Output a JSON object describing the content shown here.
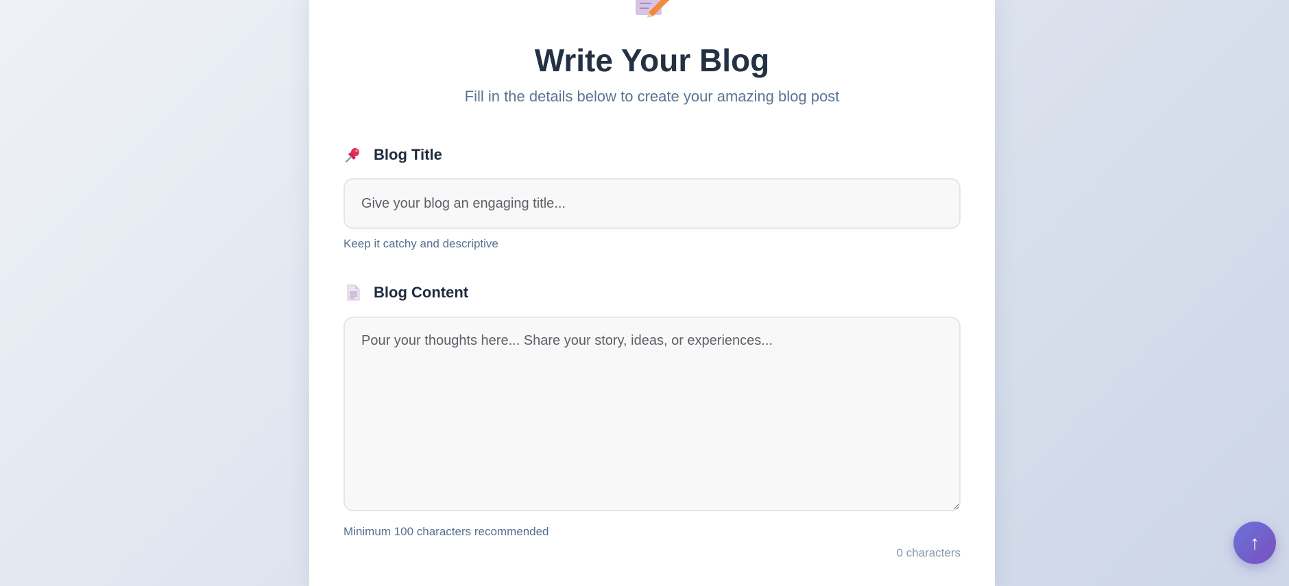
{
  "header": {
    "hero_icon": "memo-pencil-icon",
    "title": "Write Your Blog",
    "subtitle": "Fill in the details below to create your amazing blog post"
  },
  "form": {
    "title_field": {
      "icon": "pushpin-icon",
      "label": "Blog Title",
      "value": "",
      "placeholder": "Give your blog an engaging title...",
      "hint": "Keep it catchy and descriptive"
    },
    "content_field": {
      "icon": "document-icon",
      "label": "Blog Content",
      "value": "",
      "placeholder": "Pour your thoughts here... Share your story, ideas, or experiences...",
      "hint": "Minimum 100 characters recommended",
      "char_count": "0 characters"
    }
  },
  "scroll_top_button": {
    "icon": "arrow-up-icon",
    "label": "↑"
  },
  "colors": {
    "title": "#233143",
    "subtitle": "#5a7493",
    "accent_start": "#6a74d8",
    "accent_end": "#7a4fc0"
  }
}
